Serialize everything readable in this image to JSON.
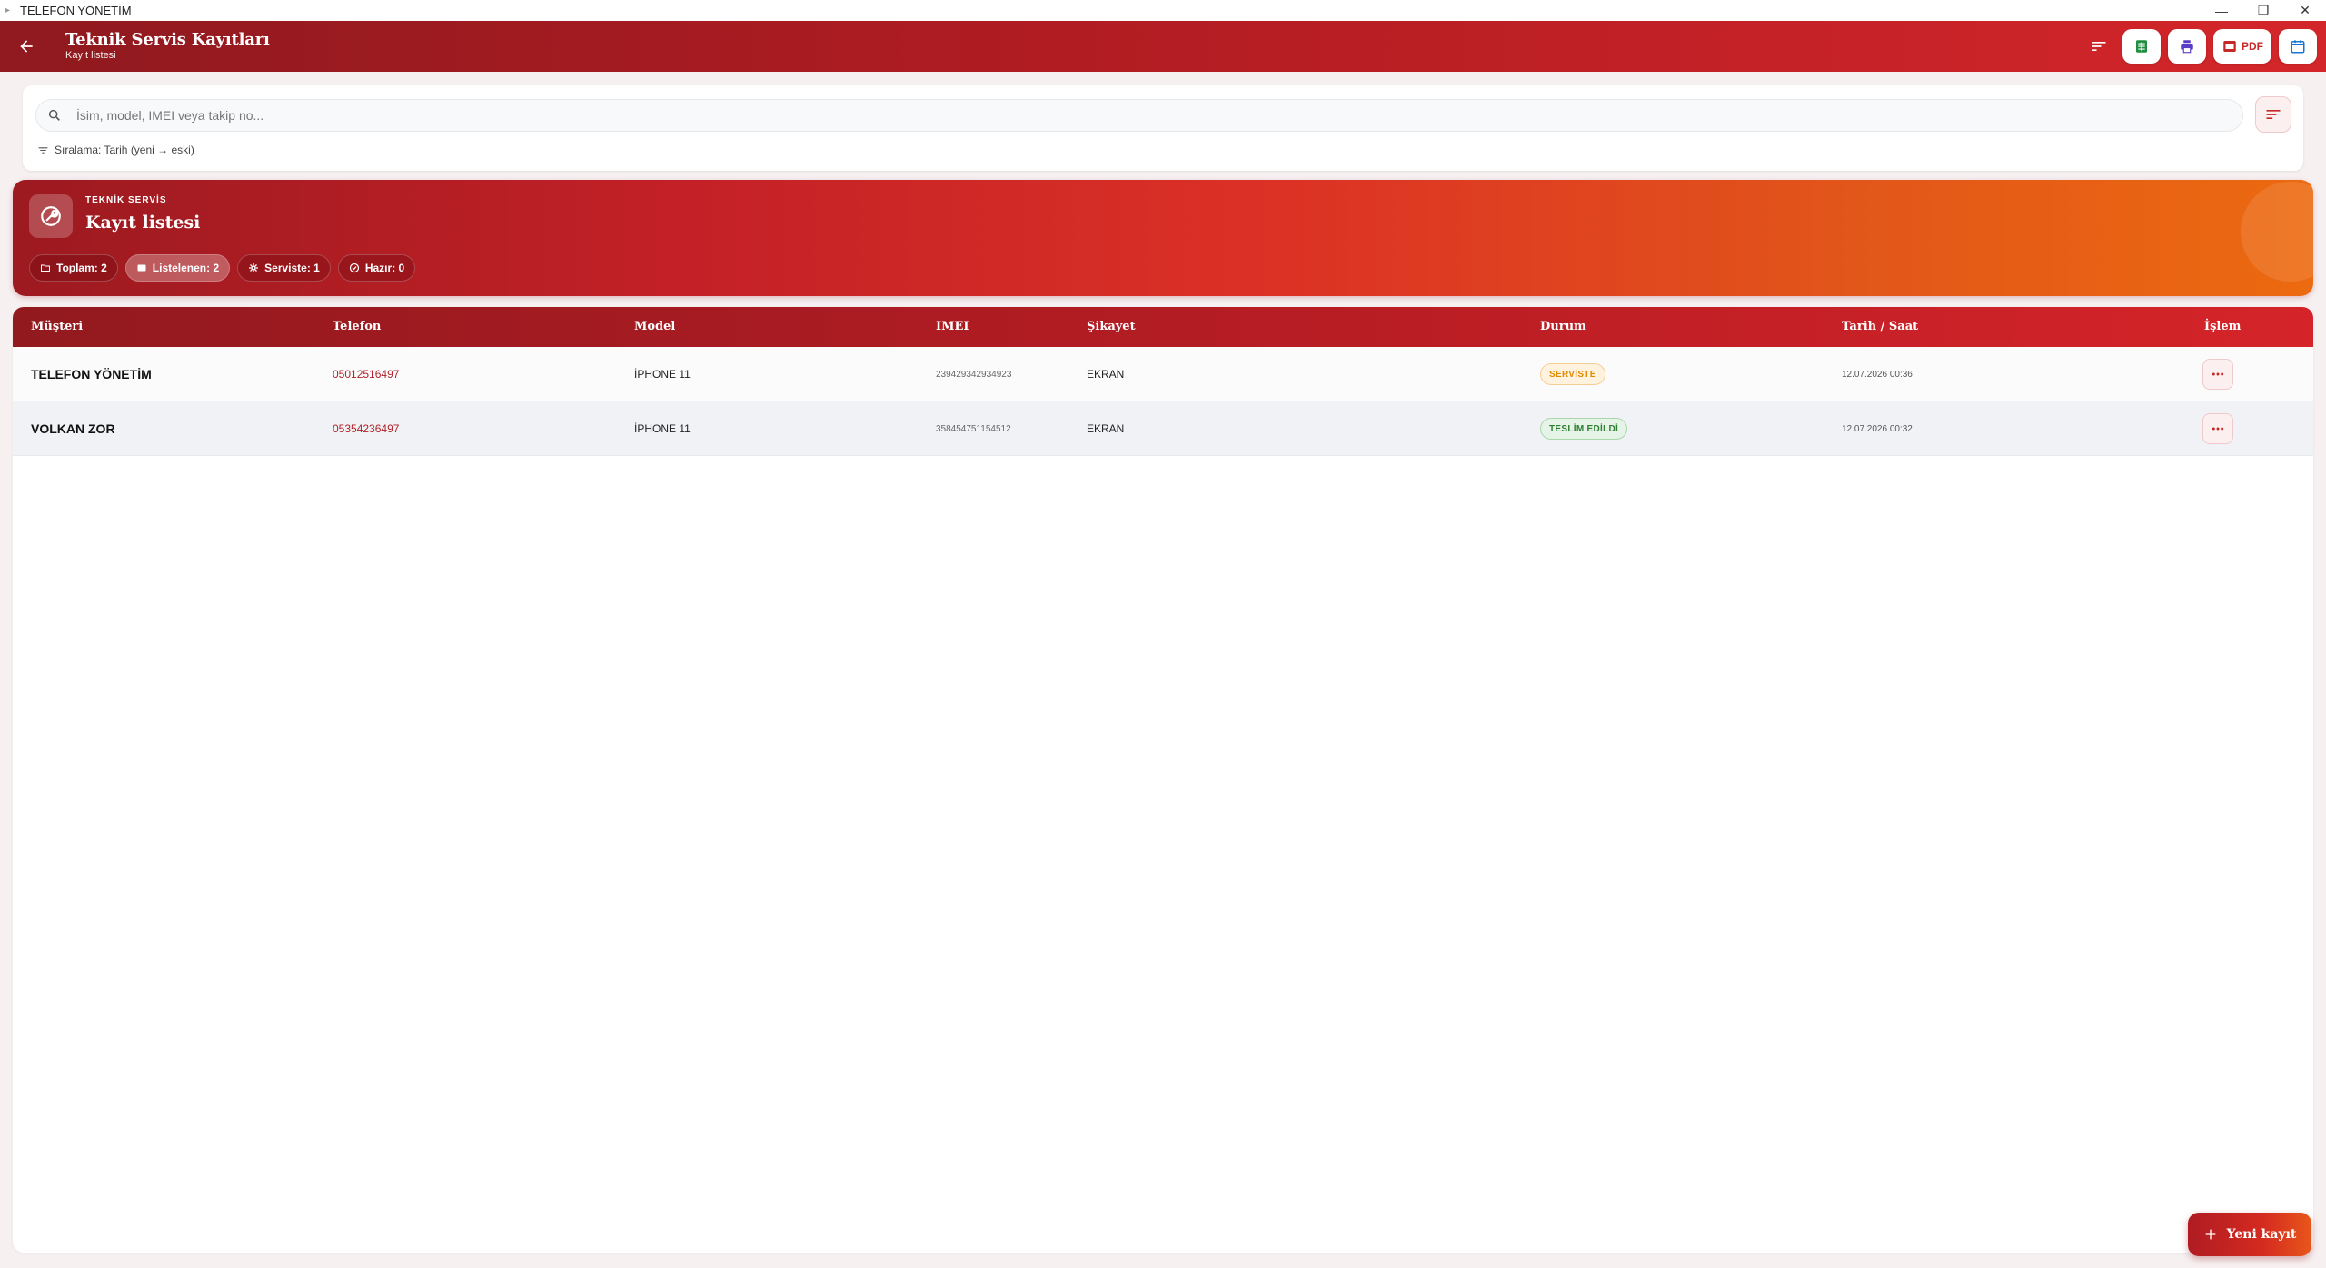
{
  "window": {
    "title": "TELEFON YÖNETİM",
    "icon": "app-icon",
    "controls": [
      "—",
      "❐",
      "✕"
    ]
  },
  "header": {
    "title": "Teknik Servis Kayıtları",
    "subtitle": "Kayıt listesi",
    "actions": {
      "pdf_label": "PDF"
    },
    "colors": {
      "primary": "#b01c22",
      "accent": "#e8561a"
    }
  },
  "search": {
    "placeholder": "İsim, model, IMEI veya takip no...",
    "value": "",
    "sort_info": "Sıralama: Tarih (yeni → eski)"
  },
  "hero": {
    "kicker": "TEKNİK SERVİS",
    "title": "Kayıt listesi",
    "chips": [
      {
        "icon": "folder-icon",
        "label": "Toplam: 2"
      },
      {
        "icon": "list-icon",
        "label": "Listelenen: 2"
      },
      {
        "icon": "gear-icon",
        "label": "Serviste: 1"
      },
      {
        "icon": "check-circle-icon",
        "label": "Hazır: 0"
      }
    ]
  },
  "table": {
    "columns": [
      "Müşteri",
      "Telefon",
      "Model",
      "IMEI",
      "Şikayet",
      "Durum",
      "Tarih / Saat",
      "İşlem"
    ],
    "rows": [
      {
        "musteri": "TELEFON YÖNETİM",
        "telefon": "05012516497",
        "model": "İPHONE 11",
        "imei": "239429342934923",
        "sikayet": "EKRAN",
        "durum": "SERVİSTE",
        "durum_color": "#e08a00",
        "tarih": "12.07.2026 00:36"
      },
      {
        "musteri": "VOLKAN ZOR",
        "telefon": "05354236497",
        "model": "İPHONE 11",
        "imei": "358454751154512",
        "sikayet": "EKRAN",
        "durum": "TESLİM EDİLDİ",
        "durum_color": "#2e7d32",
        "tarih": "12.07.2026 00:32"
      }
    ]
  },
  "fab": {
    "label": "Yeni kayıt"
  }
}
